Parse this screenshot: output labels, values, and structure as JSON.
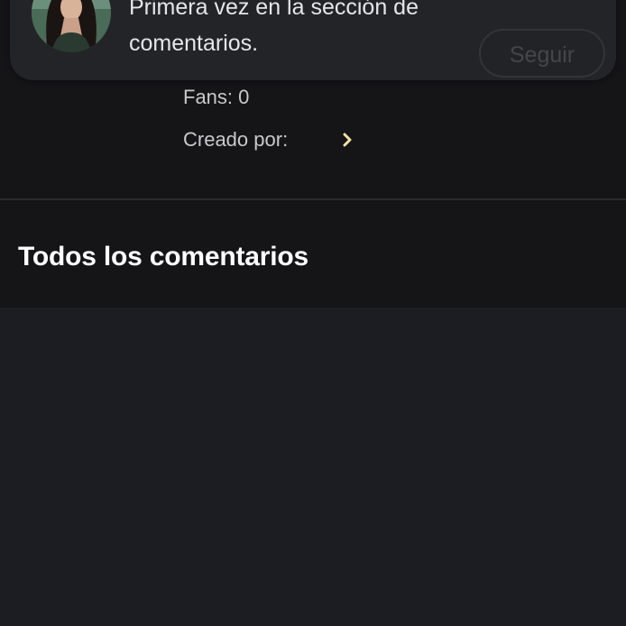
{
  "notification": {
    "message": "Primera vez en la sección de comentarios.",
    "follow_label": "Seguir"
  },
  "profile": {
    "fans_label": "Fans: 0",
    "creator_label": "Creado por",
    "creator_separator": ":"
  },
  "comments": {
    "title": "Todos los comentarios"
  },
  "colors": {
    "top_background": "#151518",
    "page_background": "#1c1d22",
    "chevron_accent": "#f3dfa6"
  }
}
